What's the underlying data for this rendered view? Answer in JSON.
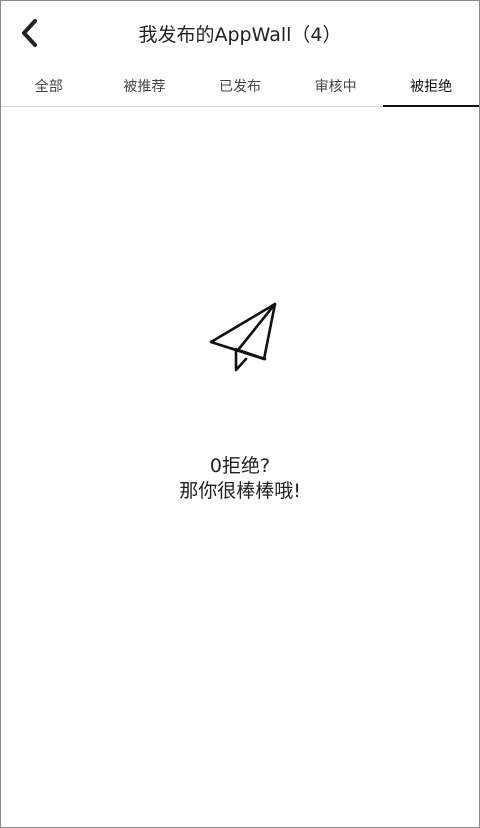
{
  "header": {
    "back_icon": "chevron-left-icon",
    "title": "我发布的AppWall（4）"
  },
  "tabs": [
    {
      "label": "全部",
      "active": false
    },
    {
      "label": "被推荐",
      "active": false
    },
    {
      "label": "已发布",
      "active": false
    },
    {
      "label": "审核中",
      "active": false
    },
    {
      "label": "被拒绝",
      "active": true
    }
  ],
  "empty_state": {
    "icon": "paper-plane-icon",
    "line1": "0拒绝?",
    "line2": "那你很棒棒哦!"
  }
}
